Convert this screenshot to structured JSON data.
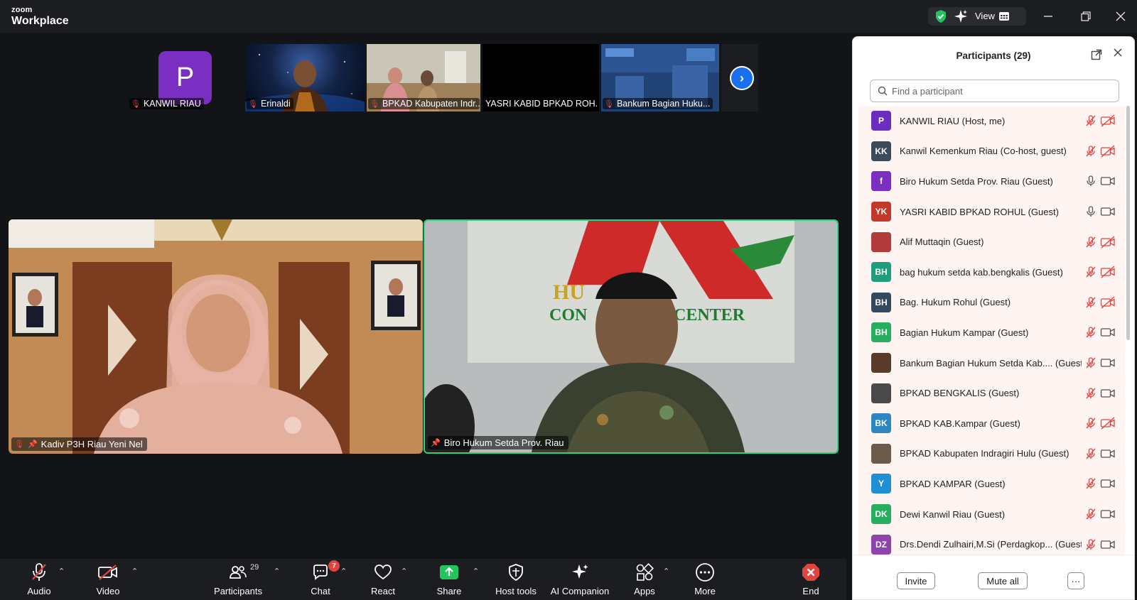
{
  "app": {
    "brand_top": "zoom",
    "brand_bottom": "Workplace",
    "view_label": "View"
  },
  "thumbnails": [
    {
      "name": "KANWIL RIAU",
      "avatar_letter": "P"
    },
    {
      "name": "Erinaldi"
    },
    {
      "name": "BPKAD Kabupaten Indr..."
    },
    {
      "name": "YASRI KABID BPKAD ROH..."
    },
    {
      "name": "Bankum Bagian Huku..."
    }
  ],
  "tiles": {
    "left_name": "Kadiv P3H Riau Yeni Nel",
    "right_name": "Biro Hukum Setda Prov. Riau"
  },
  "toolbar": {
    "audio": "Audio",
    "video": "Video",
    "participants": "Participants",
    "participants_count": "29",
    "chat": "Chat",
    "chat_badge": "7",
    "react": "React",
    "share": "Share",
    "host_tools": "Host tools",
    "ai_companion": "AI Companion",
    "apps": "Apps",
    "more": "More",
    "end": "End"
  },
  "panel": {
    "title": "Participants (29)",
    "search_placeholder": "Find a participant",
    "invite": "Invite",
    "mute_all": "Mute all",
    "more": "···",
    "participants": [
      {
        "name": "KANWIL RIAU (Host, me)",
        "initials": "P",
        "color": "#6b2fbf",
        "mic": "muted",
        "cam": "off"
      },
      {
        "name": "Kanwil Kemenkum Riau (Co-host, guest)",
        "initials": "KK",
        "color": "#3c4a5e",
        "mic": "muted",
        "cam": "off"
      },
      {
        "name": "Biro Hukum Setda Prov. Riau (Guest)",
        "initials": "f",
        "color": "#7a2fc2",
        "mic": "on",
        "cam": "on"
      },
      {
        "name": "YASRI KABID BPKAD ROHUL (Guest)",
        "initials": "YK",
        "color": "#c0392b",
        "mic": "on",
        "cam": "on"
      },
      {
        "name": "Alif Muttaqin (Guest)",
        "initials": "",
        "color": "#b33a3a",
        "mic": "muted",
        "cam": "off"
      },
      {
        "name": "bag hukum setda kab.bengkalis (Guest)",
        "initials": "BH",
        "color": "#1e9e7a",
        "mic": "muted",
        "cam": "off"
      },
      {
        "name": "Bag. Hukum Rohul (Guest)",
        "initials": "BH",
        "color": "#34495e",
        "mic": "muted",
        "cam": "off"
      },
      {
        "name": "Bagian Hukum Kampar (Guest)",
        "initials": "BH",
        "color": "#27ae60",
        "mic": "muted",
        "cam": "on"
      },
      {
        "name": "Bankum Bagian Hukum Setda Kab.... (Guest)",
        "initials": "",
        "color": "#5a3a2a",
        "mic": "muted",
        "cam": "on"
      },
      {
        "name": "BPKAD BENGKALIS (Guest)",
        "initials": "",
        "color": "#4a4a4a",
        "mic": "muted",
        "cam": "on"
      },
      {
        "name": "BPKAD KAB.Kampar (Guest)",
        "initials": "BK",
        "color": "#2e86c1",
        "mic": "muted",
        "cam": "off"
      },
      {
        "name": "BPKAD Kabupaten Indragiri Hulu (Guest)",
        "initials": "",
        "color": "#6d5a4a",
        "mic": "muted",
        "cam": "on"
      },
      {
        "name": "BPKAD KAMPAR (Guest)",
        "initials": "Y",
        "color": "#1f8fd6",
        "mic": "muted",
        "cam": "on"
      },
      {
        "name": "Dewi Kanwil Riau (Guest)",
        "initials": "DK",
        "color": "#27ae60",
        "mic": "muted",
        "cam": "on"
      },
      {
        "name": "Drs.Dendi Zulhairi,M.Si (Perdagkop... (Guest)",
        "initials": "DZ",
        "color": "#8e44ad",
        "mic": "muted",
        "cam": "on"
      }
    ]
  }
}
